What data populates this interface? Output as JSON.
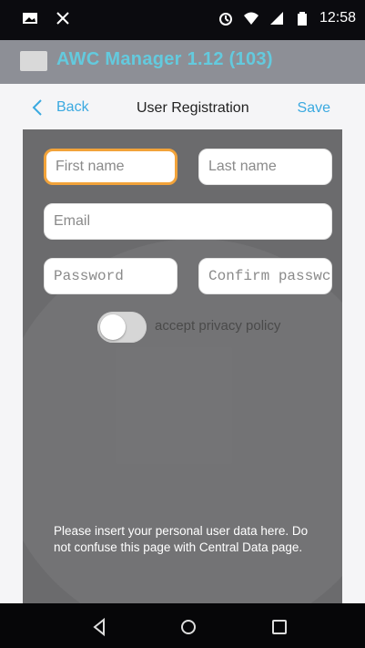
{
  "status": {
    "time": "12:58"
  },
  "app": {
    "title": "AWC Manager 1.12 (103)"
  },
  "nav": {
    "back_label": "Back",
    "title": "User Registration",
    "save_label": "Save"
  },
  "form": {
    "first_name_placeholder": "First name",
    "last_name_placeholder": "Last name",
    "email_placeholder": "Email",
    "password_placeholder": "Password",
    "confirm_password_placeholder": "Confirm passwc",
    "privacy_label": "accept privacy policy"
  },
  "note": "Please insert your personal user data here. Do not confuse this page with Central Data page.",
  "colors": {
    "accent": "#3aa9e0",
    "focus": "#f2a33a",
    "panel": "#6b6b6d",
    "appbar": "#8d8f96"
  }
}
